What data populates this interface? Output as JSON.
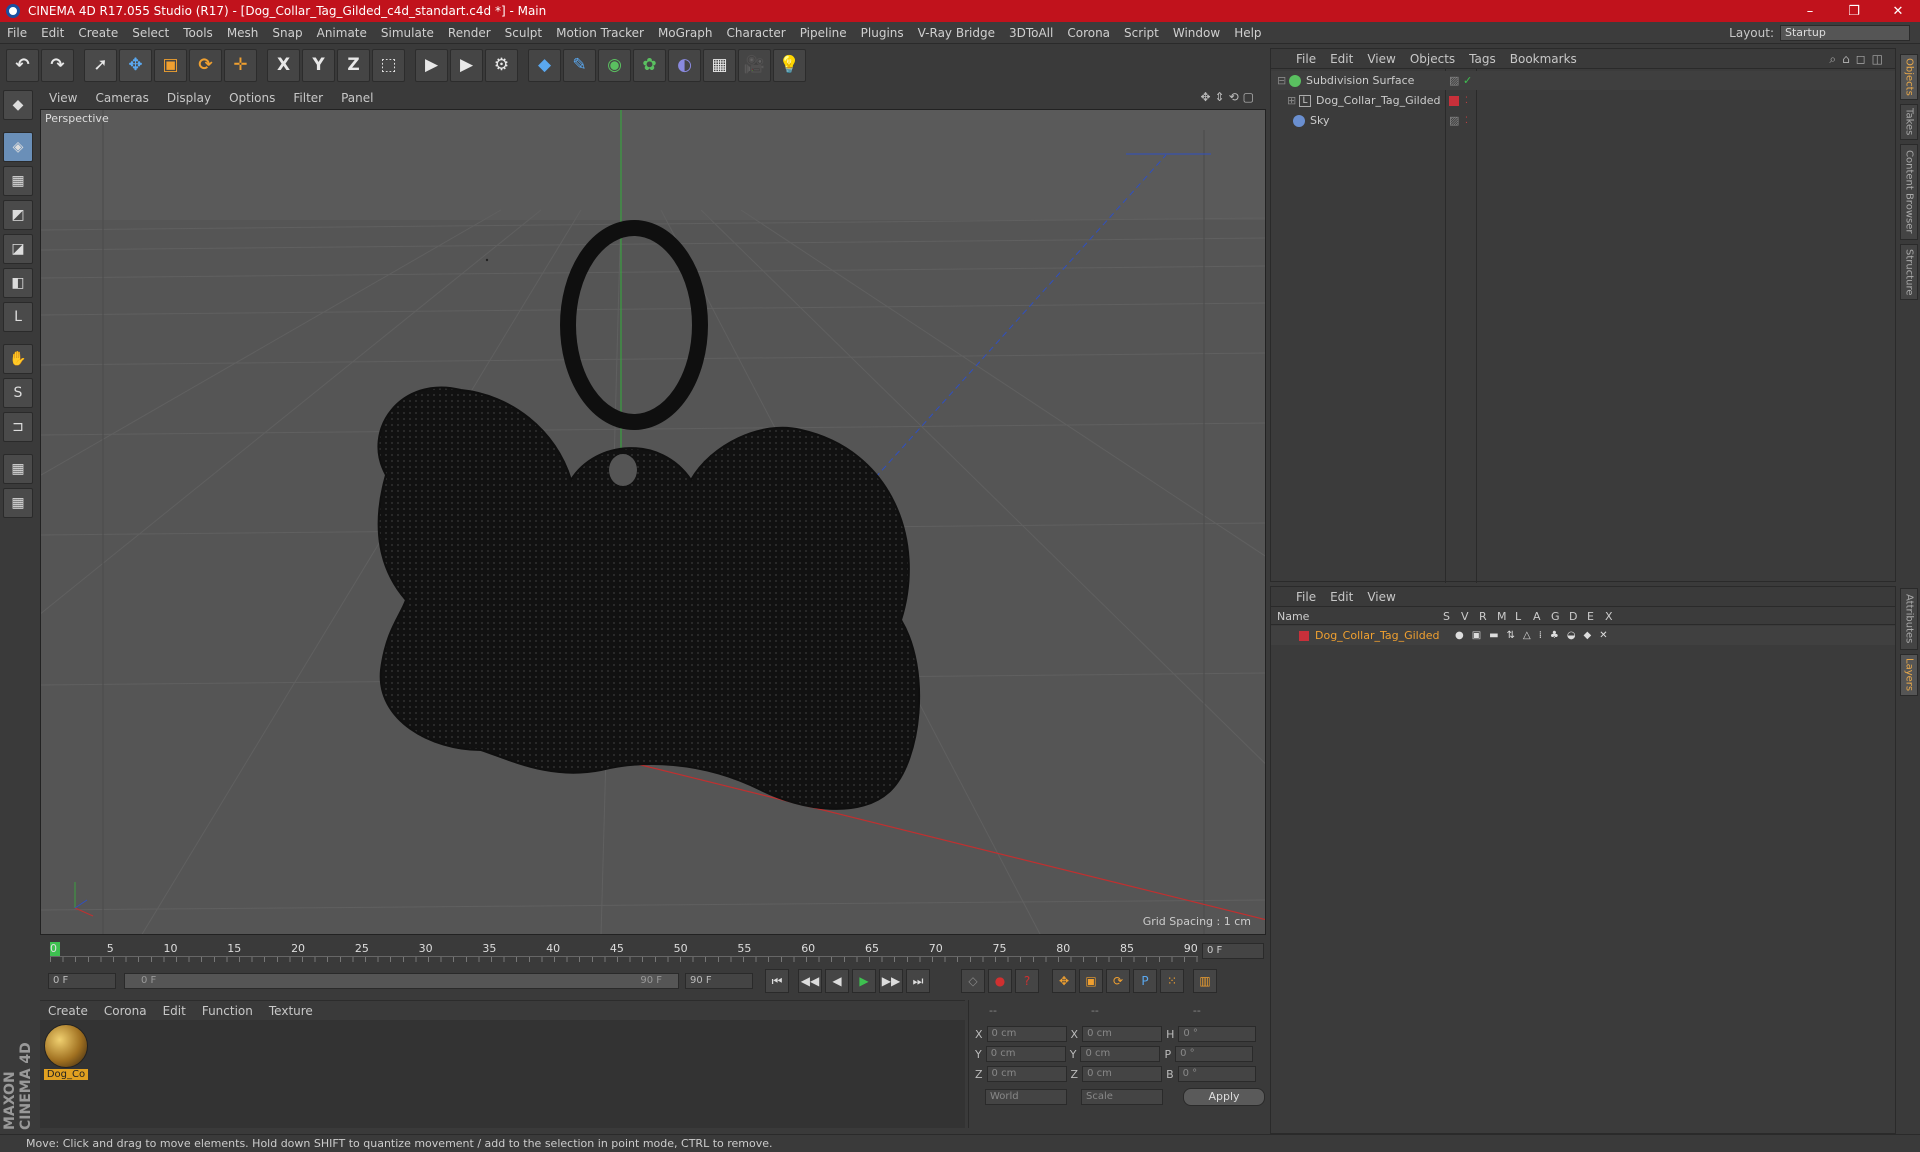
{
  "window": {
    "title": "CINEMA 4D R17.055 Studio (R17) - [Dog_Collar_Tag_Gilded_c4d_standart.c4d *] - Main",
    "minimize": "–",
    "maximize": "❐",
    "close": "✕"
  },
  "menubar": {
    "items": [
      "File",
      "Edit",
      "Create",
      "Select",
      "Tools",
      "Mesh",
      "Snap",
      "Animate",
      "Simulate",
      "Render",
      "Sculpt",
      "Motion Tracker",
      "MoGraph",
      "Character",
      "Pipeline",
      "Plugins",
      "V-Ray Bridge",
      "3DToAll",
      "Corona",
      "Script",
      "Window",
      "Help"
    ],
    "layout_label": "Layout:",
    "layout_value": "Startup"
  },
  "toolbar": {
    "undo": "↶",
    "redo": "↷",
    "select_tool": "➚",
    "move_tool": "✥",
    "scale_tool": "▣",
    "rotate_tool": "⟳",
    "move_plus": "✛",
    "x_axis": "X",
    "y_axis": "Y",
    "z_axis": "Z",
    "coord_system": "⬚",
    "render_view": "▶",
    "render_pic": "▶",
    "render_settings": "⚙",
    "cube": "◆",
    "pen": "✎",
    "nurbs": "◉",
    "array": "✿",
    "deformer": "◐",
    "floor": "▦",
    "camera": "🎥",
    "light": "💡"
  },
  "left_tools": [
    "◆",
    "◈",
    "▦",
    "◩",
    "◪",
    "◧",
    "L",
    "✋",
    "S",
    "⊐",
    "▦",
    "▦"
  ],
  "viewport": {
    "menu": [
      "View",
      "Cameras",
      "Display",
      "Options",
      "Filter",
      "Panel"
    ],
    "icons": "✥⇕⟲▢",
    "camera_label": "Perspective",
    "grid_spacing": "Grid Spacing : 1 cm",
    "colors": {
      "bg": "#555555",
      "grid": "#606060",
      "object": "#111111",
      "y_axis": "#3aa040",
      "x_axis": "#c03030",
      "z_axis": "#3050c0"
    }
  },
  "timeline": {
    "ticks": [
      "0",
      "5",
      "10",
      "15",
      "20",
      "25",
      "30",
      "35",
      "40",
      "45",
      "50",
      "55",
      "60",
      "65",
      "70",
      "75",
      "80",
      "85",
      "90"
    ],
    "current_frame": "0 F"
  },
  "transport": {
    "start_field": "0 F",
    "range_start": "0 F",
    "range_end": "90 F",
    "end_field": "90 F",
    "buttons": [
      "⏮",
      "◀◀",
      "◀",
      "▶",
      "▶▶",
      "⏭"
    ]
  },
  "material_manager": {
    "menu": [
      "Create",
      "Corona",
      "Edit",
      "Function",
      "Texture"
    ],
    "materials": [
      {
        "name": "Dog_Co"
      }
    ]
  },
  "coordinates": {
    "header": [
      "--",
      "--",
      "--"
    ],
    "rows": [
      {
        "a": "X",
        "v1": "0 cm",
        "b": "X",
        "v2": "0 cm",
        "c": "H",
        "v3": "0 °"
      },
      {
        "a": "Y",
        "v1": "0 cm",
        "b": "Y",
        "v2": "0 cm",
        "c": "P",
        "v3": "0 °"
      },
      {
        "a": "Z",
        "v1": "0 cm",
        "b": "Z",
        "v2": "0 cm",
        "c": "B",
        "v3": "0 °"
      }
    ],
    "world": "World",
    "scale": "Scale",
    "apply": "Apply"
  },
  "object_manager": {
    "menu": [
      "File",
      "Edit",
      "View",
      "Objects",
      "Tags",
      "Bookmarks"
    ],
    "objects": [
      {
        "name": "Subdivision Surface",
        "indent": 0
      },
      {
        "name": "Dog_Collar_Tag_Gilded",
        "indent": 1
      },
      {
        "name": "Sky",
        "indent": 0
      }
    ]
  },
  "layer_manager": {
    "menu": [
      "File",
      "Edit",
      "View"
    ],
    "columns": [
      "Name",
      "S",
      "V",
      "R",
      "M",
      "L",
      "A",
      "G",
      "D",
      "E",
      "X"
    ],
    "layers": [
      {
        "name": "Dog_Collar_Tag_Gilded",
        "color": "#c8303a"
      }
    ]
  },
  "side_tabs": [
    "Objects",
    "Takes",
    "Content Browser",
    "Structure",
    "Attributes",
    "Layers"
  ],
  "status": "Move: Click and drag to move elements. Hold down SHIFT to quantize movement / add to the selection in point mode, CTRL to remove.",
  "brand": "MAXON CINEMA 4D"
}
